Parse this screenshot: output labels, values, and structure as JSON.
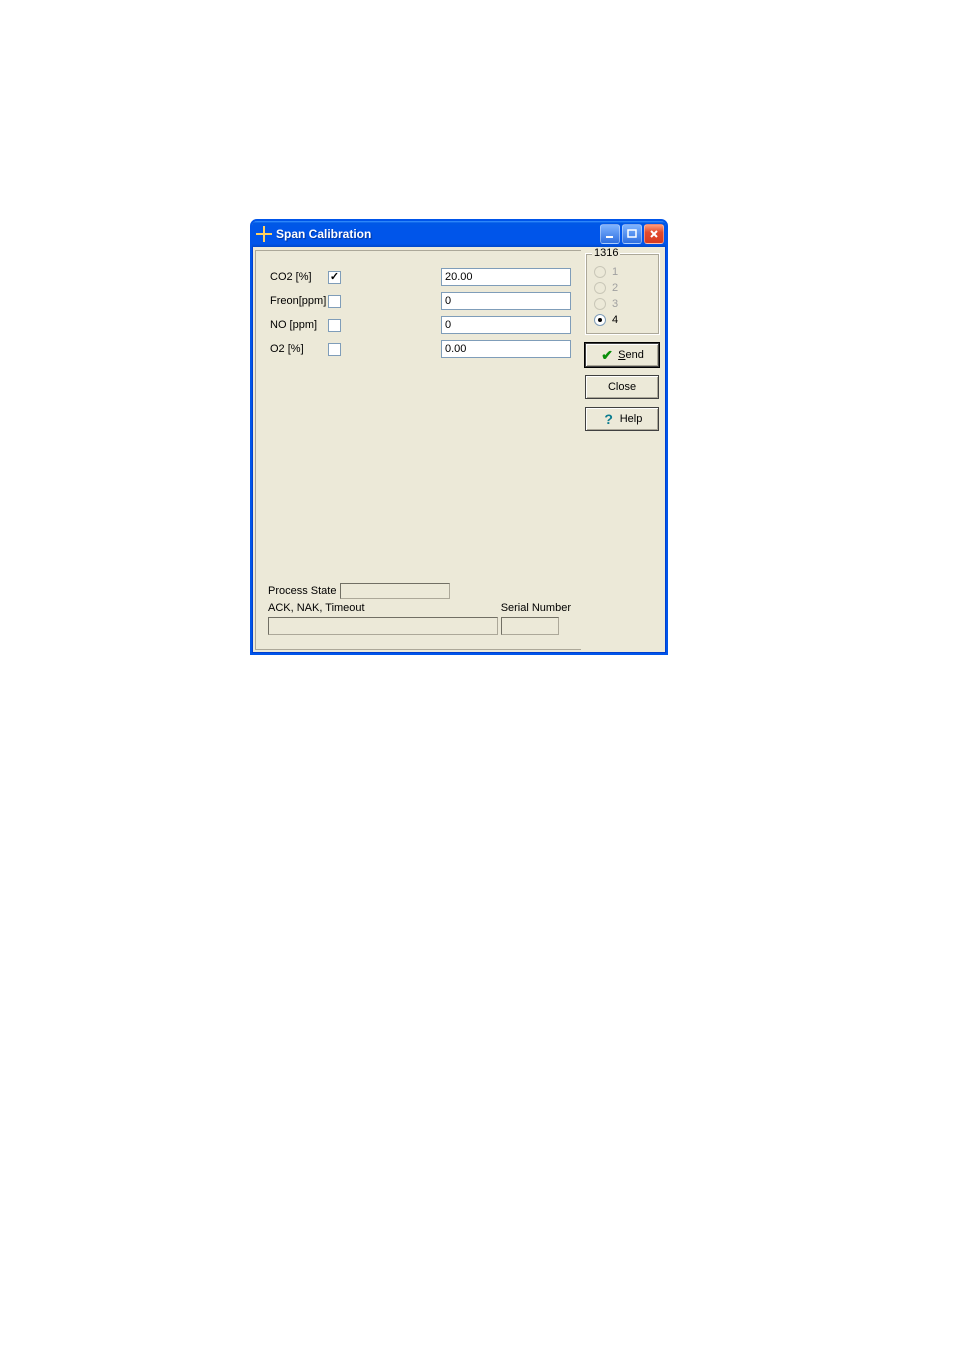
{
  "window": {
    "title": "Span Calibration"
  },
  "gases": {
    "rows": [
      {
        "label": "CO2 [%]",
        "checked": true,
        "value": "20.00"
      },
      {
        "label": "Freon[ppm]",
        "checked": false,
        "value": "0"
      },
      {
        "label": "NO [ppm]",
        "checked": false,
        "value": "0"
      },
      {
        "label": "O2 [%]",
        "checked": false,
        "value": "0.00"
      }
    ]
  },
  "status": {
    "process_state_label": "Process State",
    "ack_label": "ACK, NAK, Timeout",
    "serial_label": "Serial Number"
  },
  "group": {
    "title": "1316",
    "options": [
      {
        "label": "1",
        "selected": false,
        "enabled": false
      },
      {
        "label": "2",
        "selected": false,
        "enabled": false
      },
      {
        "label": "3",
        "selected": false,
        "enabled": false
      },
      {
        "label": "4",
        "selected": true,
        "enabled": true
      }
    ]
  },
  "buttons": {
    "send": "Send",
    "close": "Close",
    "help": "Help"
  }
}
